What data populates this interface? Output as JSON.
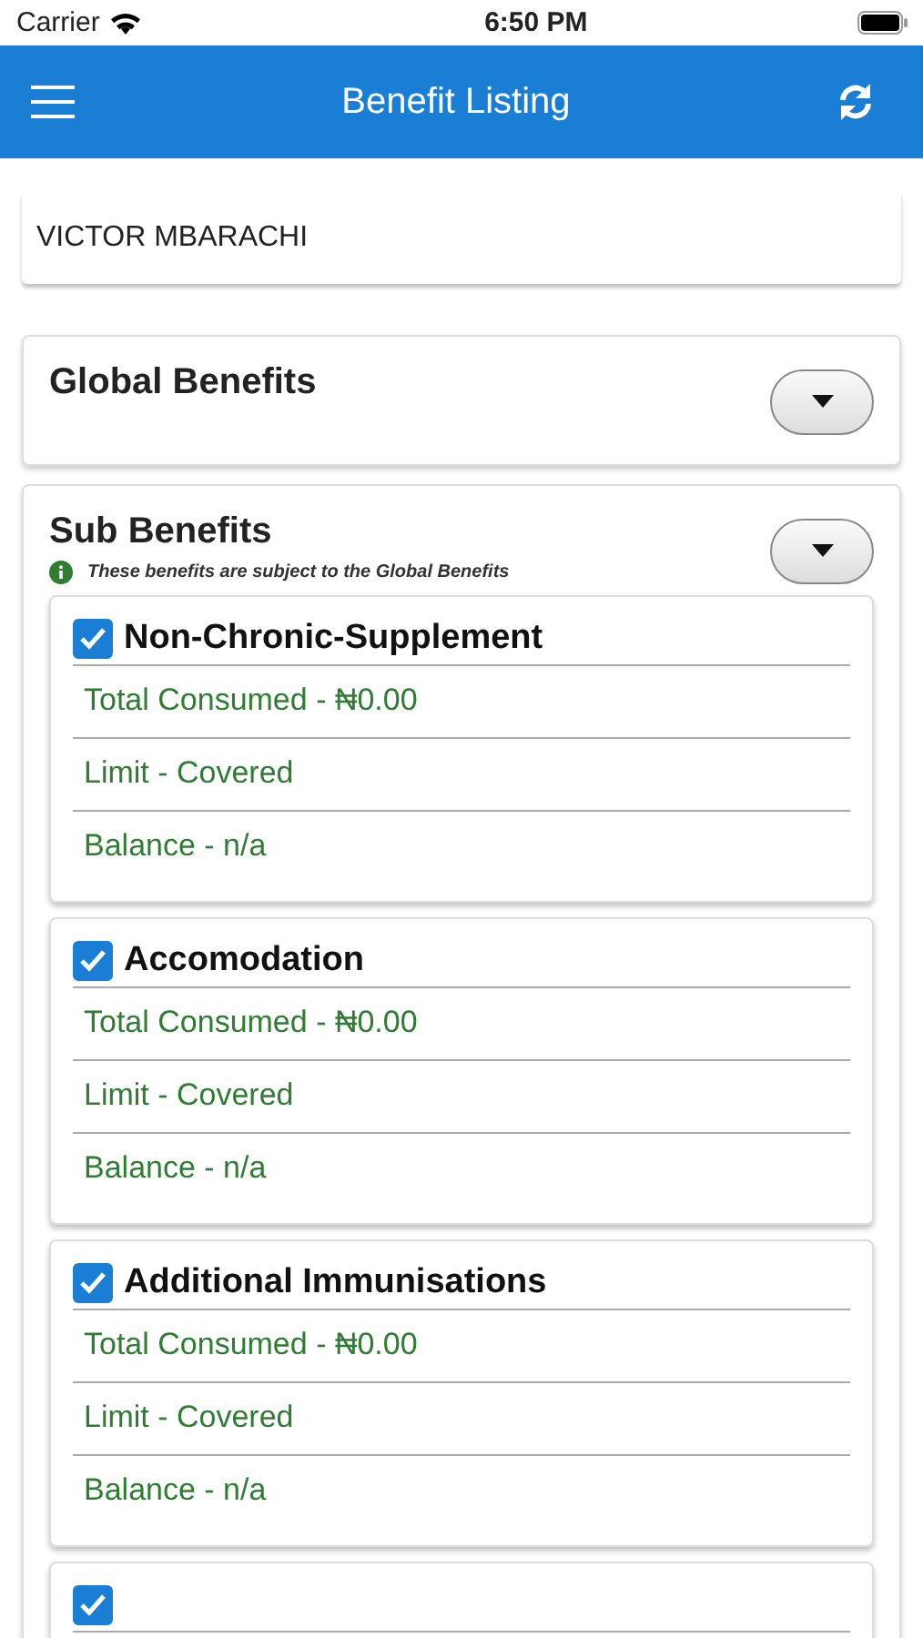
{
  "status_bar": {
    "carrier": "Carrier",
    "time": "6:50 PM"
  },
  "header": {
    "title": "Benefit Listing"
  },
  "member": {
    "name": "VICTOR MBARACHI"
  },
  "sections": [
    {
      "title": "Global Benefits",
      "expanded": false
    },
    {
      "title": "Sub Benefits",
      "expanded": false,
      "note": "These benefits are subject to the Global Benefits",
      "items": [
        {
          "name": "Non-Chronic-Supplement",
          "checked": true,
          "lines": [
            "Total Consumed - ₦0.00",
            "Limit - Covered",
            "Balance - n/a"
          ]
        },
        {
          "name": "Accomodation",
          "checked": true,
          "lines": [
            "Total Consumed - ₦0.00",
            "Limit - Covered",
            "Balance - n/a"
          ]
        },
        {
          "name": "Additional Immunisations",
          "checked": true,
          "lines": [
            "Total Consumed - ₦0.00",
            "Limit - Covered",
            "Balance - n/a"
          ]
        },
        {
          "checked": true
        }
      ]
    }
  ]
}
